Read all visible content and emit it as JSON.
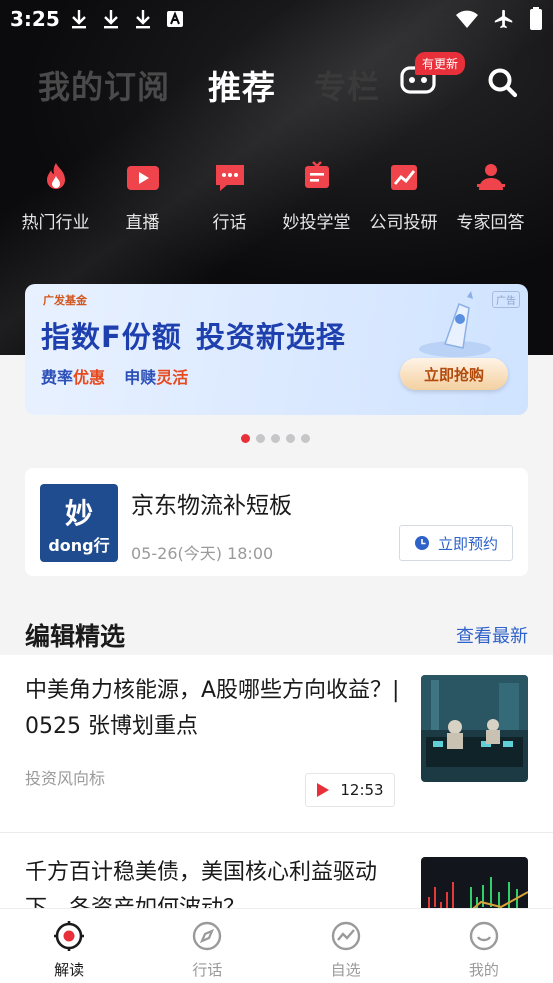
{
  "status_bar": {
    "time": "3:25"
  },
  "top_tabs": [
    {
      "label": "我的订阅"
    },
    {
      "label": "推荐"
    },
    {
      "label": "专栏"
    }
  ],
  "update_badge": "有更新",
  "categories": [
    {
      "label": "热门行业",
      "icon": "flame-icon"
    },
    {
      "label": "直播",
      "icon": "play-icon"
    },
    {
      "label": "行话",
      "icon": "chat-icon"
    },
    {
      "label": "妙投学堂",
      "icon": "classroom-icon"
    },
    {
      "label": "公司投研",
      "icon": "chart-icon"
    },
    {
      "label": "专家回答",
      "icon": "expert-icon"
    }
  ],
  "banner": {
    "logo": "广发基金",
    "ad_tag": "广告",
    "title_part1": "指数F份额",
    "title_part2": "投资新选择",
    "sub_part1": "费率",
    "sub_hl1": "优惠",
    "sub_part2": "申赎",
    "sub_hl2": "灵活",
    "cta": "立即抢购"
  },
  "carousel": {
    "count": 5,
    "active": 0
  },
  "live_card": {
    "thumb_line1": "妙",
    "thumb_line2": "dong行",
    "title": "京东物流补短板",
    "time": "05-26(今天) 18:00",
    "reserve_label": "立即预约"
  },
  "editor_picks": {
    "title": "编辑精选",
    "more_label": "查看最新",
    "articles": [
      {
        "title": "中美角力核能源，A股哪些方向收益？| 0525 张博划重点",
        "source": "投资风向标",
        "duration": "12:53"
      },
      {
        "title": "千方百计稳美债，美国核心利益驱动下，各资产如何波动？",
        "source": "",
        "duration": ""
      }
    ]
  },
  "bottom_nav": [
    {
      "label": "解读",
      "icon": "target-icon",
      "active": true
    },
    {
      "label": "行话",
      "icon": "compass-icon",
      "active": false
    },
    {
      "label": "自选",
      "icon": "trend-icon",
      "active": false
    },
    {
      "label": "我的",
      "icon": "smile-icon",
      "active": false
    }
  ],
  "colors": {
    "accent_red": "#e8303a",
    "link_blue": "#2f62c9"
  }
}
